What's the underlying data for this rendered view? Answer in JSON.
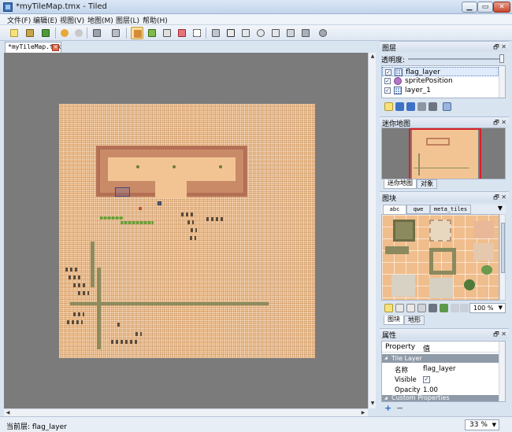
{
  "window": {
    "title": "*myTileMap.tmx - Tiled",
    "min_label": "▁",
    "max_label": "▭",
    "close_label": "✕"
  },
  "menu": [
    {
      "label": "文件(F)"
    },
    {
      "label": "编辑(E)"
    },
    {
      "label": "视图(V)"
    },
    {
      "label": "地图(M)"
    },
    {
      "label": "图层(L)"
    },
    {
      "label": "帮助(H)"
    }
  ],
  "toolbar": {
    "icons": [
      "new-file-icon",
      "open-folder-icon",
      "save-icon",
      "undo-icon",
      "redo-icon",
      "zoom-icon",
      "layer-tools-icon",
      "stamp-brush-icon",
      "terrain-brush-icon",
      "bucket-fill-icon",
      "eraser-icon",
      "rect-select-icon",
      "select-objects-icon",
      "edit-polygons-icon",
      "insert-rect-icon",
      "insert-ellipse-icon",
      "insert-polygon-icon",
      "insert-polyline-icon",
      "insert-tile-icon",
      "random-mode-icon"
    ],
    "active_tool": "stamp-brush-icon"
  },
  "document_tab": {
    "label": "*myTileMap.tmx",
    "close": "✕"
  },
  "layers_panel": {
    "title": "图层",
    "opacity_label": "透明度:",
    "opacity": 1.0,
    "layers": [
      {
        "name": "flag_layer",
        "visible": true,
        "type": "tile",
        "selected": true
      },
      {
        "name": "spritePosition",
        "visible": true,
        "type": "object",
        "selected": false
      },
      {
        "name": "layer_1",
        "visible": true,
        "type": "tile",
        "selected": false
      }
    ]
  },
  "minimap_panel": {
    "title": "迷你地图",
    "tabs": [
      {
        "label": "迷你地图",
        "selected": true
      },
      {
        "label": "对象",
        "selected": false
      }
    ]
  },
  "tileset_panel": {
    "title": "图块",
    "tilesets": [
      {
        "label": "abc",
        "selected": true
      },
      {
        "label": "qwe",
        "selected": false
      },
      {
        "label": "meta_tiles",
        "selected": false
      }
    ],
    "more": "▼",
    "zoom": "100 %",
    "bottom_tabs": [
      {
        "label": "图块",
        "selected": true
      },
      {
        "label": "地形",
        "selected": false
      }
    ]
  },
  "properties_panel": {
    "title": "属性",
    "header_property": "Property",
    "header_value": "值",
    "group_tile_layer": "Tile Layer",
    "rows": [
      {
        "key": "名称",
        "value": "flag_layer"
      },
      {
        "key": "Visible",
        "value": "✓"
      },
      {
        "key": "Opacity",
        "value": "1.00"
      }
    ],
    "group_custom": "Custom Properties",
    "add": "+",
    "remove": "−"
  },
  "panel_buttons": "🗗 ✕",
  "status": {
    "current_layer": "当前层: flag_layer",
    "zoom": "33 %",
    "zoom_arrow": "▼"
  }
}
